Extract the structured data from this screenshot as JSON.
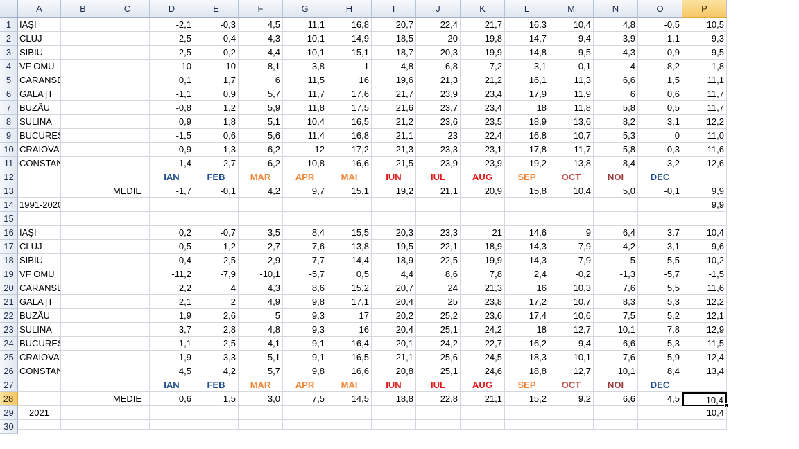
{
  "columns": [
    "A",
    "B",
    "C",
    "D",
    "E",
    "F",
    "G",
    "H",
    "I",
    "J",
    "K",
    "L",
    "M",
    "N",
    "O",
    "P"
  ],
  "selected_column": "P",
  "selected_row": 28,
  "active_cell": "P28",
  "month_colors": {
    "IAN": "#1f4e8c",
    "FEB": "#1f4e8c",
    "MAR": "#f0883a",
    "APR": "#f0883a",
    "MAI": "#f0883a",
    "IUN": "#e01b1b",
    "IUL": "#e01b1b",
    "AUG": "#e01b1b",
    "SEP": "#f0883a",
    "OCT": "#c0504d",
    "NOI": "#9b3b3b",
    "DEC": "#1f4e8c"
  },
  "rows": [
    {
      "n": "1",
      "cells": {
        "A": "IAŞI",
        "D": "-2,1",
        "E": "-0,3",
        "F": "4,5",
        "G": "11,1",
        "H": "16,8",
        "I": "20,7",
        "J": "22,4",
        "K": "21,7",
        "L": "16,3",
        "M": "10,4",
        "N": "4,8",
        "O": "-0,5",
        "P": "10,5"
      }
    },
    {
      "n": "2",
      "cells": {
        "A": "CLUJ",
        "D": "-2,5",
        "E": "-0,4",
        "F": "4,3",
        "G": "10,1",
        "H": "14,9",
        "I": "18,5",
        "J": "20",
        "K": "19,8",
        "L": "14,7",
        "M": "9,4",
        "N": "3,9",
        "O": "-1,1",
        "P": "9,3"
      }
    },
    {
      "n": "3",
      "cells": {
        "A": "SIBIU",
        "D": "-2,5",
        "E": "-0,2",
        "F": "4,4",
        "G": "10,1",
        "H": "15,1",
        "I": "18,7",
        "J": "20,3",
        "K": "19,9",
        "L": "14,8",
        "M": "9,5",
        "N": "4,3",
        "O": "-0,9",
        "P": "9,5"
      }
    },
    {
      "n": "4",
      "cells": {
        "A": "VF OMU",
        "D": "-10",
        "E": "-10",
        "F": "-8,1",
        "G": "-3,8",
        "H": "1",
        "I": "4,8",
        "J": "6,8",
        "K": "7,2",
        "L": "3,1",
        "M": "-0,1",
        "N": "-4",
        "O": "-8,2",
        "P": "-1,8"
      }
    },
    {
      "n": "5",
      "cells": {
        "A": "CARANSEBEŞ",
        "D": "0,1",
        "E": "1,7",
        "F": "6",
        "G": "11,5",
        "H": "16",
        "I": "19,6",
        "J": "21,3",
        "K": "21,2",
        "L": "16,1",
        "M": "11,3",
        "N": "6,6",
        "O": "1,5",
        "P": "11,1"
      }
    },
    {
      "n": "6",
      "cells": {
        "A": "GALAŢI",
        "D": "-1,1",
        "E": "0,9",
        "F": "5,7",
        "G": "11,7",
        "H": "17,6",
        "I": "21,7",
        "J": "23,9",
        "K": "23,4",
        "L": "17,9",
        "M": "11,9",
        "N": "6",
        "O": "0,6",
        "P": "11,7"
      }
    },
    {
      "n": "7",
      "cells": {
        "A": "BUZĂU",
        "D": "-0,8",
        "E": "1,2",
        "F": "5,9",
        "G": "11,8",
        "H": "17,5",
        "I": "21,6",
        "J": "23,7",
        "K": "23,4",
        "L": "18",
        "M": "11,8",
        "N": "5,8",
        "O": "0,5",
        "P": "11,7"
      }
    },
    {
      "n": "8",
      "cells": {
        "A": "SULINA",
        "D": "0,9",
        "E": "1,8",
        "F": "5,1",
        "G": "10,4",
        "H": "16,5",
        "I": "21,2",
        "J": "23,6",
        "K": "23,5",
        "L": "18,9",
        "M": "13,6",
        "N": "8,2",
        "O": "3,1",
        "P": "12,2"
      }
    },
    {
      "n": "9",
      "cells": {
        "A": "BUCUREŞTI BĂNEASA",
        "D": "-1,5",
        "E": "0,6",
        "F": "5,6",
        "G": "11,4",
        "H": "16,8",
        "I": "21,1",
        "J": "23",
        "K": "22,4",
        "L": "16,8",
        "M": "10,7",
        "N": "5,3",
        "O": "0",
        "P": "11,0"
      }
    },
    {
      "n": "10",
      "cells": {
        "A": "CRAIOVA",
        "D": "-0,9",
        "E": "1,3",
        "F": "6,2",
        "G": "12",
        "H": "17,2",
        "I": "21,3",
        "J": "23,3",
        "K": "23,1",
        "L": "17,8",
        "M": "11,7",
        "N": "5,8",
        "O": "0,3",
        "P": "11,6"
      }
    },
    {
      "n": "11",
      "cells": {
        "A": "CONSTANŢA",
        "D": "1,4",
        "E": "2,7",
        "F": "6,2",
        "G": "10,8",
        "H": "16,6",
        "I": "21,5",
        "J": "23,9",
        "K": "23,9",
        "L": "19,2",
        "M": "13,8",
        "N": "8,4",
        "O": "3,2",
        "P": "12,6"
      }
    },
    {
      "n": "12",
      "months": true,
      "cells": {
        "D": "IAN",
        "E": "FEB",
        "F": "MAR",
        "G": "APR",
        "H": "MAI",
        "I": "IUN",
        "J": "IUL",
        "K": "AUG",
        "L": "SEP",
        "M": "OCT",
        "N": "NOI",
        "O": "DEC"
      }
    },
    {
      "n": "13",
      "cells": {
        "C": "MEDIE",
        "D": "-1,7",
        "E": "-0,1",
        "F": "4,2",
        "G": "9,7",
        "H": "15,1",
        "I": "19,2",
        "J": "21,1",
        "K": "20,9",
        "L": "15,8",
        "M": "10,4",
        "N": "5,0",
        "O": "-0,1",
        "P": "9,9"
      }
    },
    {
      "n": "14",
      "cells": {
        "A": "1991-2020",
        "P": "9,9"
      }
    },
    {
      "n": "15",
      "cells": {}
    },
    {
      "n": "16",
      "cells": {
        "A": "IAŞI",
        "D": "0,2",
        "E": "-0,7",
        "F": "3,5",
        "G": "8,4",
        "H": "15,5",
        "I": "20,3",
        "J": "23,3",
        "K": "21",
        "L": "14,6",
        "M": "9",
        "N": "6,4",
        "O": "3,7",
        "P": "10,4"
      }
    },
    {
      "n": "17",
      "cells": {
        "A": "CLUJ",
        "D": "-0,5",
        "E": "1,2",
        "F": "2,7",
        "G": "7,6",
        "H": "13,8",
        "I": "19,5",
        "J": "22,1",
        "K": "18,9",
        "L": "14,3",
        "M": "7,9",
        "N": "4,2",
        "O": "3,1",
        "P": "9,6"
      }
    },
    {
      "n": "18",
      "cells": {
        "A": "SIBIU",
        "D": "0,4",
        "E": "2,5",
        "F": "2,9",
        "G": "7,7",
        "H": "14,4",
        "I": "18,9",
        "J": "22,5",
        "K": "19,9",
        "L": "14,3",
        "M": "7,9",
        "N": "5",
        "O": "5,5",
        "P": "10,2"
      }
    },
    {
      "n": "19",
      "cells": {
        "A": "VF OMU",
        "D": "-11,2",
        "E": "-7,9",
        "F": "-10,1",
        "G": "-5,7",
        "H": "0,5",
        "I": "4,4",
        "J": "8,6",
        "K": "7,8",
        "L": "2,4",
        "M": "-0,2",
        "N": "-1,3",
        "O": "-5,7",
        "P": "-1,5"
      }
    },
    {
      "n": "20",
      "cells": {
        "A": "CARANSEBEŞ",
        "D": "2,2",
        "E": "4",
        "F": "4,3",
        "G": "8,6",
        "H": "15,2",
        "I": "20,7",
        "J": "24",
        "K": "21,3",
        "L": "16",
        "M": "10,3",
        "N": "7,6",
        "O": "5,5",
        "P": "11,6"
      }
    },
    {
      "n": "21",
      "cells": {
        "A": "GALAŢI",
        "D": "2,1",
        "E": "2",
        "F": "4,9",
        "G": "9,8",
        "H": "17,1",
        "I": "20,4",
        "J": "25",
        "K": "23,8",
        "L": "17,2",
        "M": "10,7",
        "N": "8,3",
        "O": "5,3",
        "P": "12,2"
      }
    },
    {
      "n": "22",
      "cells": {
        "A": "BUZĂU",
        "D": "1,9",
        "E": "2,6",
        "F": "5",
        "G": "9,3",
        "H": "17",
        "I": "20,2",
        "J": "25,2",
        "K": "23,6",
        "L": "17,4",
        "M": "10,6",
        "N": "7,5",
        "O": "5,2",
        "P": "12,1"
      }
    },
    {
      "n": "23",
      "cells": {
        "A": "SULINA",
        "D": "3,7",
        "E": "2,8",
        "F": "4,8",
        "G": "9,3",
        "H": "16",
        "I": "20,4",
        "J": "25,1",
        "K": "24,2",
        "L": "18",
        "M": "12,7",
        "N": "10,1",
        "O": "7,8",
        "P": "12,9"
      }
    },
    {
      "n": "24",
      "cells": {
        "A": "BUCUREŞTI BĂNEASA",
        "D": "1,1",
        "E": "2,5",
        "F": "4,1",
        "G": "9,1",
        "H": "16,4",
        "I": "20,1",
        "J": "24,2",
        "K": "22,7",
        "L": "16,2",
        "M": "9,4",
        "N": "6,6",
        "O": "5,3",
        "P": "11,5"
      }
    },
    {
      "n": "25",
      "cells": {
        "A": "CRAIOVA",
        "D": "1,9",
        "E": "3,3",
        "F": "5,1",
        "G": "9,1",
        "H": "16,5",
        "I": "21,1",
        "J": "25,6",
        "K": "24,5",
        "L": "18,3",
        "M": "10,1",
        "N": "7,6",
        "O": "5,9",
        "P": "12,4"
      }
    },
    {
      "n": "26",
      "cells": {
        "A": "CONSTANŢA",
        "D": "4,5",
        "E": "4,2",
        "F": "5,7",
        "G": "9,8",
        "H": "16,6",
        "I": "20,8",
        "J": "25,1",
        "K": "24,6",
        "L": "18,8",
        "M": "12,7",
        "N": "10,1",
        "O": "8,4",
        "P": "13,4"
      }
    },
    {
      "n": "27",
      "months": true,
      "cells": {
        "D": "IAN",
        "E": "FEB",
        "F": "MAR",
        "G": "APR",
        "H": "MAI",
        "I": "IUN",
        "J": "IUL",
        "K": "AUG",
        "L": "SEP",
        "M": "OCT",
        "N": "NOI",
        "O": "DEC"
      }
    },
    {
      "n": "28",
      "cells": {
        "C": "MEDIE",
        "D": "0,6",
        "E": "1,5",
        "F": "3,0",
        "G": "7,5",
        "H": "14,5",
        "I": "18,8",
        "J": "22,8",
        "K": "21,1",
        "L": "15,2",
        "M": "9,2",
        "N": "6,6",
        "O": "4,5",
        "P": "10,4"
      }
    },
    {
      "n": "29",
      "cells": {
        "A": "2021",
        "P": "10,4"
      }
    },
    {
      "n": "30",
      "cells": {}
    }
  ]
}
